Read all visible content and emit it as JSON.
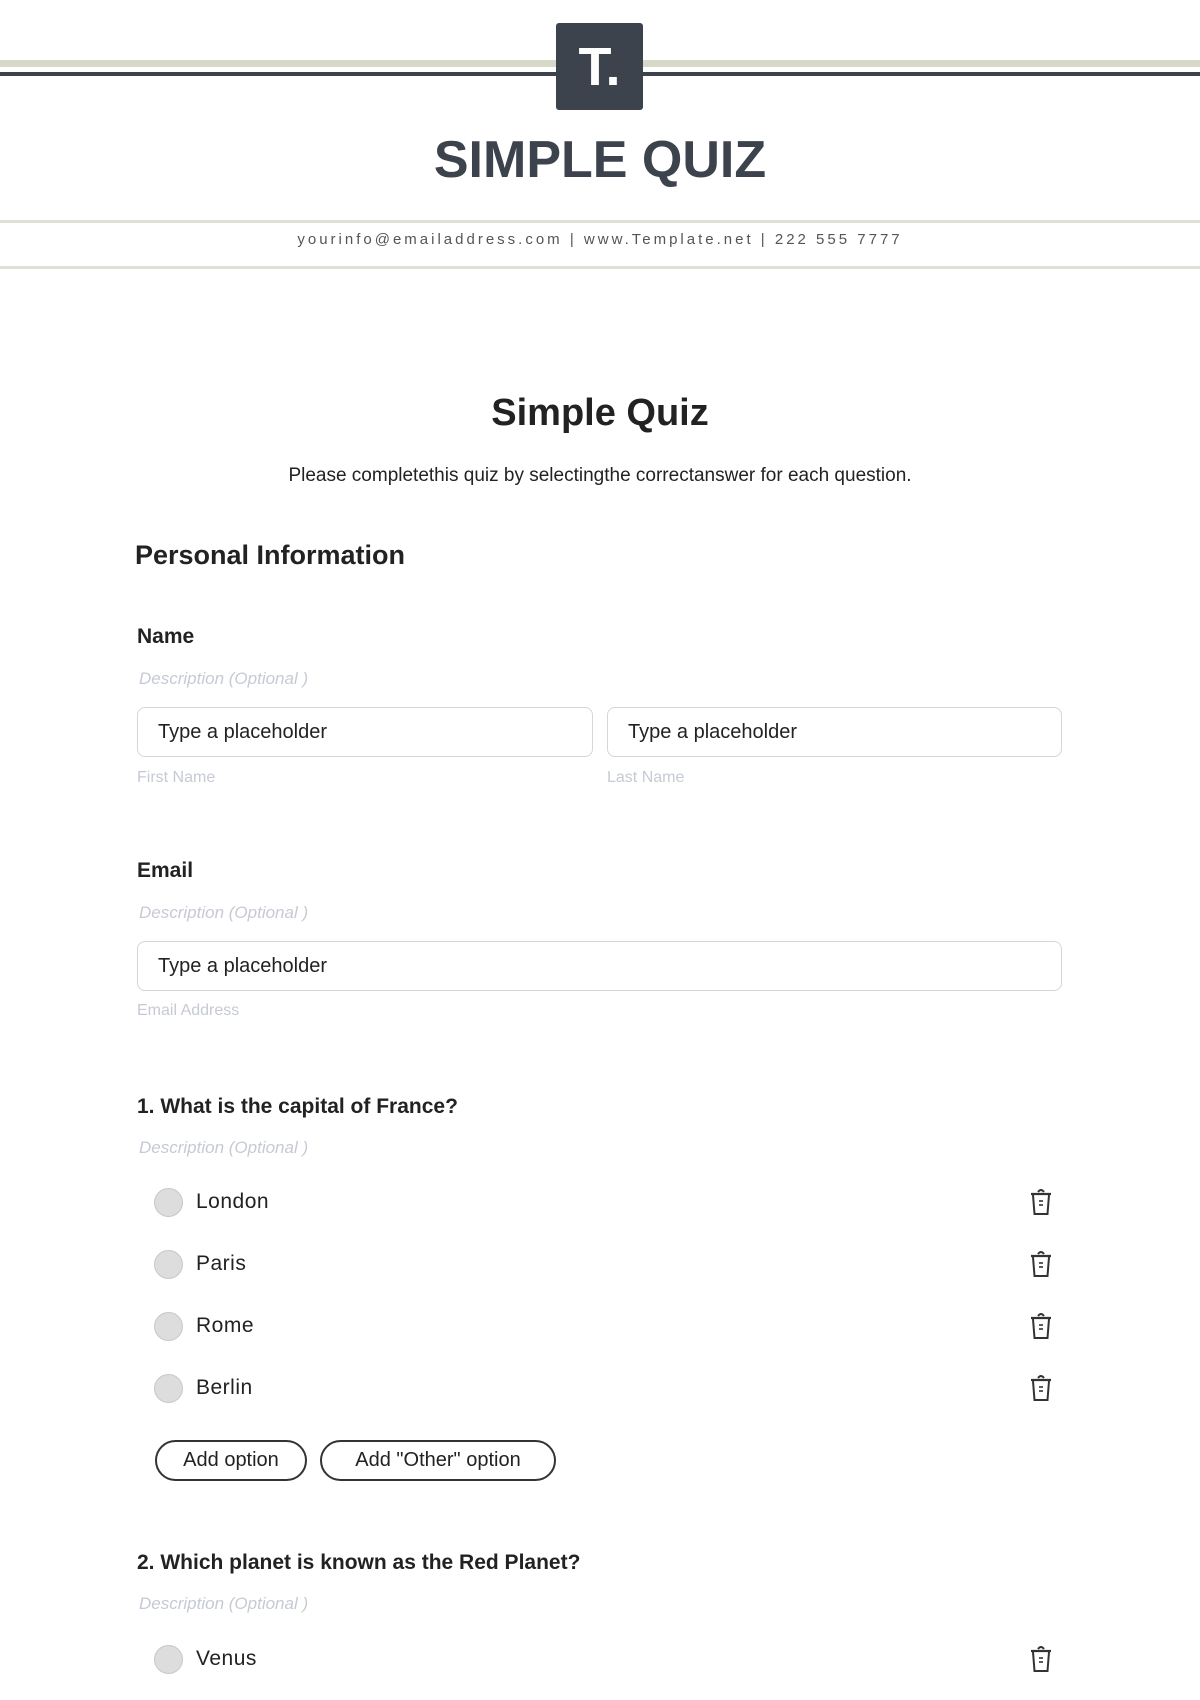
{
  "header": {
    "logo_letter": "T.",
    "brand_title": "SIMPLE QUIZ",
    "contact": "yourinfo@emailaddress.com | www.Template.net | 222 555 7777",
    "colors": {
      "dark": "#3d434c",
      "accent_line": "#d6d9c8"
    }
  },
  "form": {
    "title": "Simple Quiz",
    "subtitle": "Please completethis quiz by selectingthe correctanswer for each question.",
    "section_title": "Personal Information",
    "name": {
      "label": "Name",
      "description": "Description  (Optional )",
      "first": {
        "value": "Type a placeholder",
        "sublabel": "First Name"
      },
      "last": {
        "value": "Type a placeholder",
        "sublabel": "Last Name"
      }
    },
    "email": {
      "label": "Email",
      "description": "Description  (Optional )",
      "value": "Type a placeholder",
      "sublabel": "Email Address"
    },
    "questions": [
      {
        "label": "1. What is the capital of France?",
        "description": "Description  (Optional )",
        "options": [
          "London",
          "Paris",
          "Rome",
          "Berlin"
        ],
        "add_option": "Add option",
        "add_other_option": "Add \"Other\" option"
      },
      {
        "label": "2. Which planet is known as the Red Planet?",
        "description": "Description  (Optional )",
        "options": [
          "Venus"
        ]
      }
    ]
  }
}
